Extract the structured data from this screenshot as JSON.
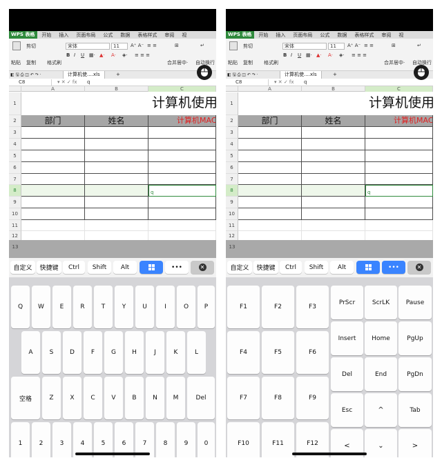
{
  "app": {
    "name": "WPS 表格",
    "menus": [
      "开始",
      "插入",
      "页面布局",
      "公式",
      "数据",
      "表格样式",
      "审阅",
      "视"
    ]
  },
  "ribbon": {
    "cut": "剪切",
    "paste": "粘贴",
    "copy": "复制",
    "format_painter": "格式刷",
    "font_name": "宋体",
    "font_size": "11",
    "bold": "B",
    "italic": "I",
    "underline": "U",
    "merge_center": "合并居中·",
    "wrap_text": "自动换行"
  },
  "doc_tab": {
    "name": "计算机使....xls",
    "add": "+"
  },
  "formula_bar": {
    "cell_ref": "C8",
    "value": "q"
  },
  "columns": [
    "A",
    "B",
    "C"
  ],
  "rows": [
    "1",
    "2",
    "3",
    "4",
    "5",
    "6",
    "7",
    "8",
    "9",
    "10",
    "11",
    "12",
    "13"
  ],
  "sheet": {
    "title": "计算机使用",
    "headers": [
      "部门",
      "姓名",
      "计算机MAC"
    ],
    "c8_value": "q"
  },
  "toolbar": {
    "custom": "自定义",
    "shortcuts": "快捷键",
    "ctrl": "Ctrl",
    "shift": "Shift",
    "alt": "Alt",
    "more": "•••",
    "close": "✕"
  },
  "keyboard_left": {
    "row1": [
      "Q",
      "W",
      "E",
      "R",
      "T",
      "Y",
      "U",
      "I",
      "O",
      "P"
    ],
    "row2": [
      "A",
      "S",
      "D",
      "F",
      "G",
      "H",
      "J",
      "K",
      "L"
    ],
    "row3": [
      "空格",
      "Z",
      "X",
      "C",
      "V",
      "B",
      "N",
      "M",
      "Del"
    ],
    "row4": [
      "1",
      "2",
      "3",
      "4",
      "5",
      "6",
      "7",
      "8",
      "9",
      "0"
    ]
  },
  "keyboard_right": {
    "fkeys": [
      [
        "F1",
        "F2",
        "F3"
      ],
      [
        "F4",
        "F5",
        "F6"
      ],
      [
        "F7",
        "F8",
        "F9"
      ],
      [
        "F10",
        "F11",
        "F12"
      ]
    ],
    "nav": [
      [
        "PrScr",
        "ScrLK",
        "Pause"
      ],
      [
        "Insert",
        "Home",
        "PgUp"
      ],
      [
        "Del",
        "End",
        "PgDn"
      ],
      [
        "Esc",
        "^",
        "Tab"
      ],
      [
        "<",
        "⌄",
        ">"
      ]
    ]
  },
  "colors": {
    "accent": "#3a84ff",
    "brand": "#2f8a3c",
    "header_red": "#e02020"
  }
}
